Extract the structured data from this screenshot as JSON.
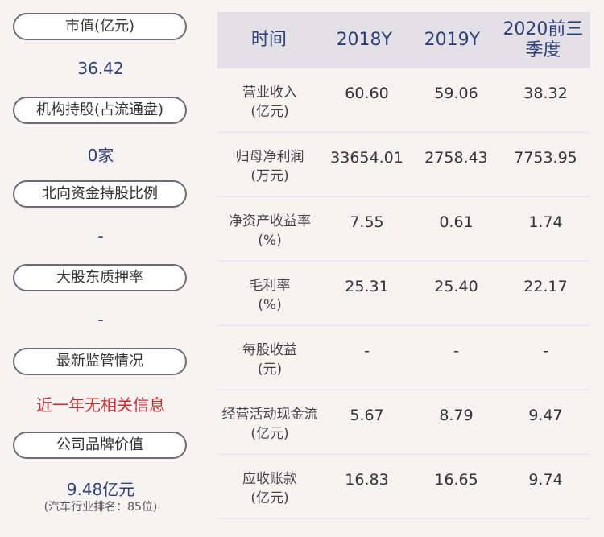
{
  "left": {
    "items": [
      {
        "label": "市值(亿元)",
        "value": "36.42"
      },
      {
        "label": "机构持股(占流通盘)",
        "value": "0家"
      },
      {
        "label": "北向资金持股比例",
        "value": "-"
      },
      {
        "label": "大股东质押率",
        "value": "-"
      },
      {
        "label": "最新监管情况",
        "value": "近一年无相关信息"
      },
      {
        "label": "公司品牌价值",
        "value": "9.48亿元",
        "note": "(汽车行业排名：85位)"
      }
    ]
  },
  "table": {
    "headers": [
      "时间",
      "2018Y",
      "2019Y",
      "2020前三季度"
    ],
    "rows": [
      {
        "label": "营业收入(亿元)",
        "values": [
          "60.60",
          "59.06",
          "38.32"
        ]
      },
      {
        "label": "归母净利润(万元)",
        "values": [
          "33654.01",
          "2758.43",
          "7753.95"
        ]
      },
      {
        "label": "净资产收益率(%)",
        "values": [
          "7.55",
          "0.61",
          "1.74"
        ]
      },
      {
        "label": "毛利率(%)",
        "values": [
          "25.31",
          "25.40",
          "22.17"
        ]
      },
      {
        "label": "每股收益(元)",
        "values": [
          "-",
          "-",
          "-"
        ]
      },
      {
        "label": "经营活动现金流(亿元)",
        "values": [
          "5.67",
          "8.79",
          "9.47"
        ]
      },
      {
        "label": "应收账款(亿元)",
        "values": [
          "16.83",
          "16.65",
          "9.74"
        ]
      }
    ]
  },
  "colors": {
    "accent": "#2d3f7c",
    "alert": "#d12b2b",
    "header_bg": "#e3e1e5"
  }
}
